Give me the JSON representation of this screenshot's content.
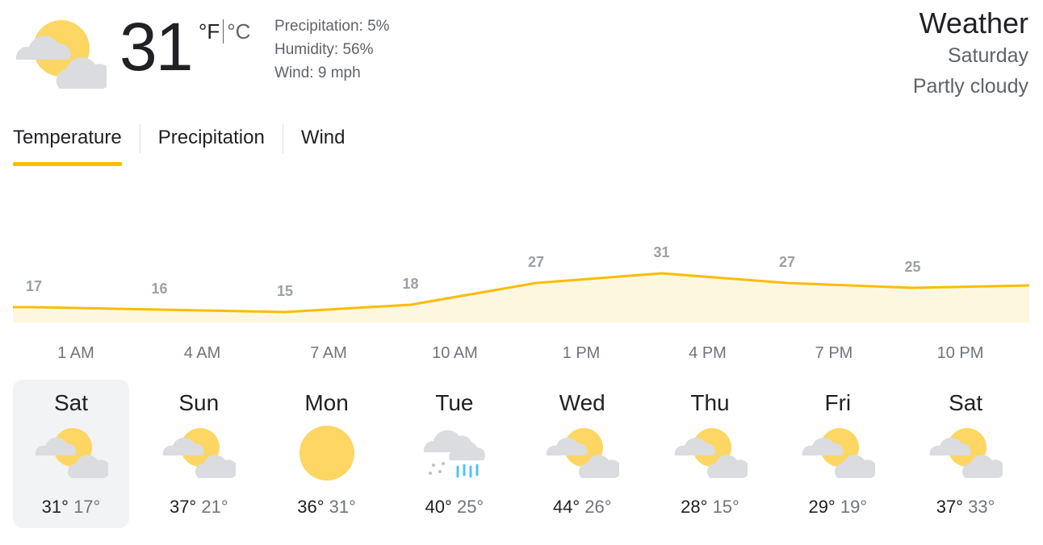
{
  "current": {
    "temperature": "31",
    "unit_f": "°F",
    "unit_c": "°C",
    "icon": "partly-cloudy-icon",
    "precipitation": "Precipitation: 5%",
    "humidity": "Humidity: 56%",
    "wind": "Wind: 9 mph"
  },
  "header": {
    "title": "Weather",
    "day": "Saturday",
    "condition": "Partly cloudy"
  },
  "tabs": [
    {
      "label": "Temperature",
      "active": true
    },
    {
      "label": "Precipitation",
      "active": false
    },
    {
      "label": "Wind",
      "active": false
    }
  ],
  "colors": {
    "accent": "#fbbc04",
    "chart_line": "#fbbc04",
    "chart_fill": "#fef7e0",
    "sun": "#fdd663",
    "cloud": "#dadce0",
    "rain": "#4fc3f7"
  },
  "chart_data": {
    "type": "area",
    "x": [
      "1 AM",
      "4 AM",
      "7 AM",
      "10 AM",
      "1 PM",
      "4 PM",
      "7 PM",
      "10 PM"
    ],
    "values": [
      17,
      16,
      15,
      18,
      27,
      31,
      27,
      25
    ],
    "labels": [
      "17",
      "16",
      "15",
      "18",
      "27",
      "31",
      "27",
      "25"
    ]
  },
  "forecast": [
    {
      "day": "Sat",
      "hi": "31°",
      "lo": "17°",
      "icon": "partly-cloudy-icon",
      "selected": true
    },
    {
      "day": "Sun",
      "hi": "37°",
      "lo": "21°",
      "icon": "partly-cloudy-icon",
      "selected": false
    },
    {
      "day": "Mon",
      "hi": "36°",
      "lo": "31°",
      "icon": "sunny-icon",
      "selected": false
    },
    {
      "day": "Tue",
      "hi": "40°",
      "lo": "25°",
      "icon": "snow-rain-icon",
      "selected": false
    },
    {
      "day": "Wed",
      "hi": "44°",
      "lo": "26°",
      "icon": "partly-cloudy-icon",
      "selected": false
    },
    {
      "day": "Thu",
      "hi": "28°",
      "lo": "15°",
      "icon": "partly-cloudy-icon",
      "selected": false
    },
    {
      "day": "Fri",
      "hi": "29°",
      "lo": "19°",
      "icon": "partly-cloudy-icon",
      "selected": false
    },
    {
      "day": "Sat",
      "hi": "37°",
      "lo": "33°",
      "icon": "partly-cloudy-icon",
      "selected": false
    }
  ]
}
